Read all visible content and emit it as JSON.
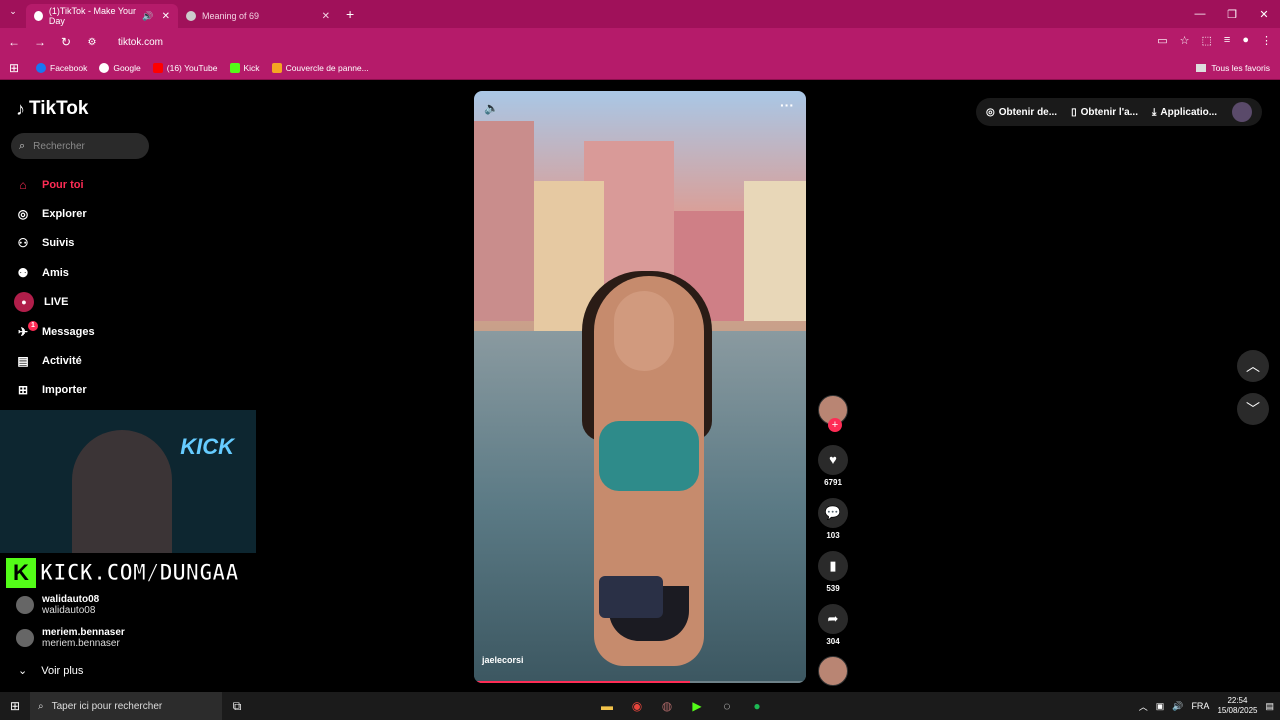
{
  "browser": {
    "tabs": [
      {
        "title": "(1)TikTok - Make Your Day",
        "active": true
      },
      {
        "title": "Meaning of 69",
        "active": false
      }
    ],
    "url": "tiktok.com",
    "bookmarks": [
      "Facebook",
      "Google",
      "(16) YouTube",
      "Kick",
      "Couvercle de panne..."
    ],
    "bookmarks_right": "Tous les favoris"
  },
  "sidebar": {
    "logo": "TikTok",
    "search_placeholder": "Rechercher",
    "items": [
      {
        "label": "Pour toi",
        "icon": "home-icon"
      },
      {
        "label": "Explorer",
        "icon": "compass-icon"
      },
      {
        "label": "Suivis",
        "icon": "following-icon"
      },
      {
        "label": "Amis",
        "icon": "friends-icon"
      },
      {
        "label": "LIVE",
        "icon": "live-icon"
      },
      {
        "label": "Messages",
        "icon": "messages-icon"
      },
      {
        "label": "Activité",
        "icon": "activity-icon"
      },
      {
        "label": "Importer",
        "icon": "upload-icon"
      }
    ],
    "messages_badge": "1",
    "following_accounts": [
      {
        "name": "walidauto08",
        "handle": "walidauto08"
      },
      {
        "name": "meriem.bennaser",
        "handle": "meriem.bennaser"
      }
    ],
    "see_more": "Voir plus"
  },
  "stream_overlay": {
    "neon": "KICK",
    "banner": "KICK.COM/DUNGAA"
  },
  "video": {
    "username": "jaelecorsi",
    "progress": 0.65
  },
  "actions": {
    "likes": "6791",
    "comments": "103",
    "saves": "539",
    "shares": "304"
  },
  "top_right": {
    "get_coins": "Obtenir de...",
    "get_app": "Obtenir l'a...",
    "app": "Applicatio..."
  },
  "taskbar": {
    "search_placeholder": "Taper ici pour rechercher",
    "language": "FRA",
    "time": "22:54",
    "date": "15/08/2025"
  }
}
